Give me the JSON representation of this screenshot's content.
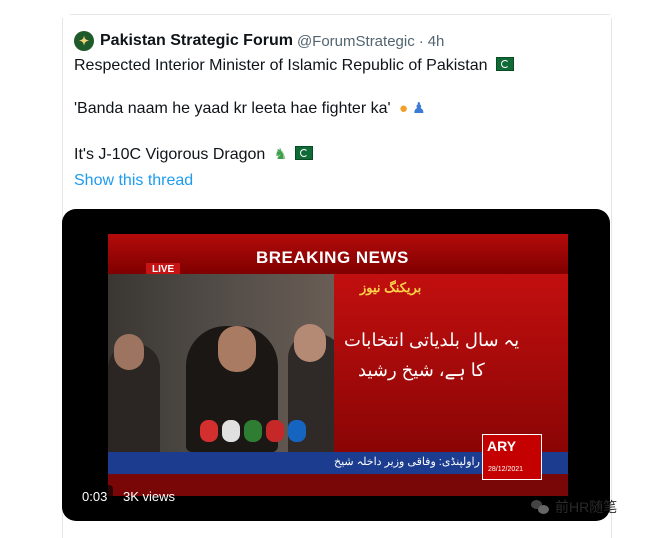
{
  "tweet": {
    "author_name": "Pakistan Strategic Forum",
    "author_handle": "@ForumStrategic",
    "separator": "·",
    "time": "4h",
    "avatar_icon": "forum-emblem-icon",
    "line1": "Respected Interior Minister of Islamic Republic of Pakistan",
    "line2": "'Banda naam he yaad kr leeta hae fighter ka'",
    "line3": "It's J-10C Vigorous Dragon",
    "show_thread": "Show this thread",
    "emoji_line1": [
      "pakistan-flag-icon"
    ],
    "emoji_line2": [
      "crying-face-icon",
      "person-facepalming-icon"
    ],
    "emoji_line3": [
      "dragon-icon",
      "pakistan-flag-icon"
    ],
    "link_color": "#1d9bf0",
    "secondary_color": "#536471"
  },
  "video": {
    "duration": "0:03",
    "views": "3K views",
    "headline": "BREAKING NEWS",
    "live_label": "LIVE",
    "urdu_label": "بریکنگ نیوز",
    "urdu_line1": "یہ سال بلدیاتی انتخابات",
    "urdu_line2": "کا ہے، شیخ رشید",
    "ticker": "راولپنڈی: وفاقی وزیر داخلہ شیخ",
    "channel": "ARY",
    "date": "28/12/2021",
    "frame_colors": {
      "banner": "#b40b0b",
      "ticker": "#1b3c8f"
    }
  },
  "watermark": {
    "icon": "wechat-icon",
    "text": "前HR随笔"
  }
}
